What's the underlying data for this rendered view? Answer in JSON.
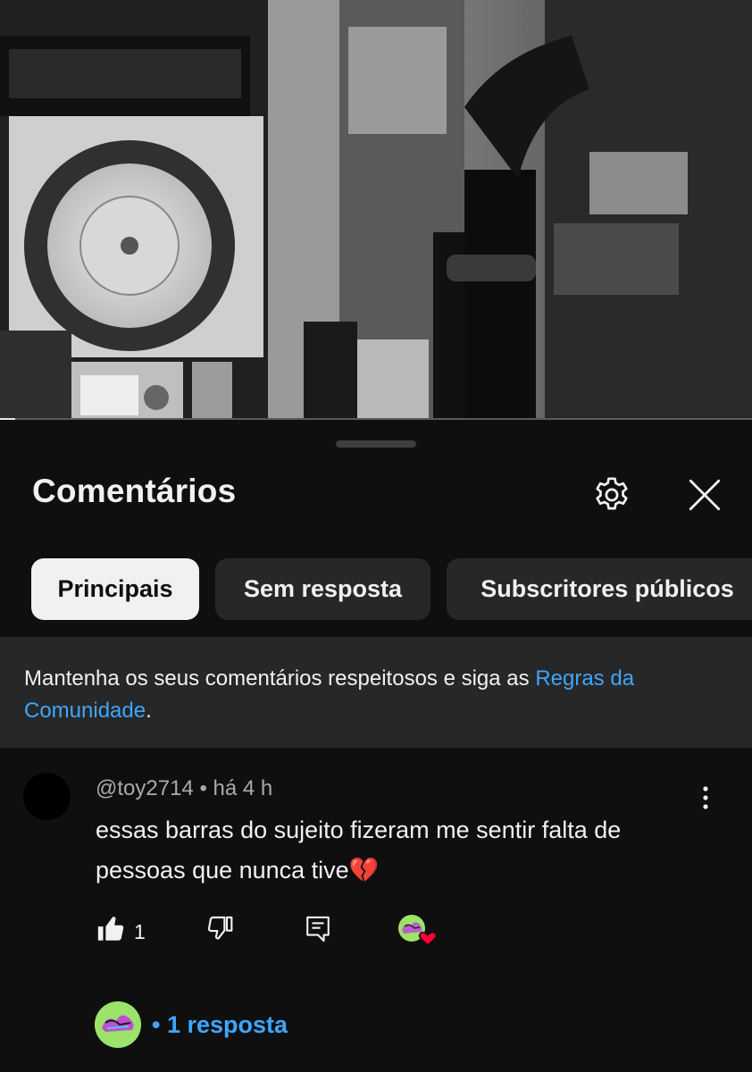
{
  "video": {
    "progress_fraction": 0.02
  },
  "sheet": {
    "title": "Comentários"
  },
  "icons": {
    "settings": "gear-icon",
    "close": "close-icon",
    "more": "more-vertical-icon",
    "like": "thumbs-up-icon",
    "dislike": "thumbs-down-icon",
    "reply": "reply-icon",
    "creator_heart": "creator-heart-icon"
  },
  "filters": [
    {
      "label": "Principais",
      "active": true
    },
    {
      "label": "Sem resposta",
      "active": false
    },
    {
      "label": "Subscritores públicos",
      "active": false
    }
  ],
  "notice": {
    "text": "Mantenha os seus comentários respeitosos e siga as ",
    "link": "Regras da Comunidade",
    "suffix": "."
  },
  "comment": {
    "author": "@toy2714",
    "separator": " • ",
    "time": "há 4 h",
    "text": "essas barras do sujeito fizeram me sentir falta de pessoas que nunca tive💔",
    "likes": "1"
  },
  "replies": {
    "label": "• 1 resposta"
  },
  "colors": {
    "background": "#0f0f0f",
    "chip": "#272727",
    "chip_active": "#f1f1f1",
    "link": "#3ea6ff",
    "heart": "#ff0033",
    "avatar_green": "#9be36a"
  }
}
